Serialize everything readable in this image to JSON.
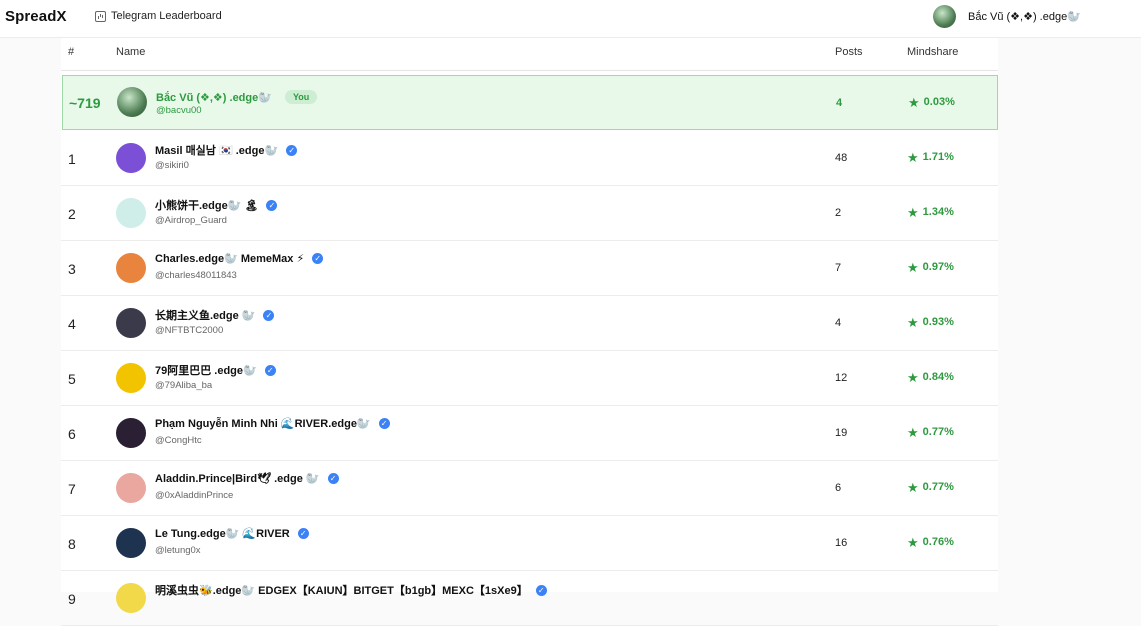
{
  "header": {
    "brand": "SpreadX",
    "nav_link": "Telegram Leaderboard",
    "user_name": "Bắc Vũ (❖,❖) .edge🦭"
  },
  "table": {
    "columns": {
      "rank": "#",
      "name": "Name",
      "posts": "Posts",
      "mindshare": "Mindshare"
    },
    "you_row": {
      "rank": "~719",
      "name": "Bắc Vũ (❖,❖) .edge🦭",
      "badge": "You",
      "handle": "@bacvu00",
      "posts": "4",
      "mindshare": "0.03%"
    },
    "rows": [
      {
        "rank": "1",
        "name": "Masil 매실남 🇰🇷 .edge🦭",
        "handle": "@sikiri0",
        "posts": "48",
        "mindshare": "1.71%",
        "color": "#7b4fd6"
      },
      {
        "rank": "2",
        "name": "小熊饼干.edge🦭 🏝",
        "handle": "@Airdrop_Guard",
        "posts": "2",
        "mindshare": "1.34%",
        "color": "#cfeee9"
      },
      {
        "rank": "3",
        "name": "Charles.edge🦭 MemeMax ⚡",
        "handle": "@charles48011843",
        "posts": "7",
        "mindshare": "0.97%",
        "color": "#e8843e"
      },
      {
        "rank": "4",
        "name": "长期主义鱼.edge 🦭",
        "handle": "@NFTBTC2000",
        "posts": "4",
        "mindshare": "0.93%",
        "color": "#3a3a4a"
      },
      {
        "rank": "5",
        "name": "79阿里巴巴 .edge🦭",
        "handle": "@79Aliba_ba",
        "posts": "12",
        "mindshare": "0.84%",
        "color": "#f2c400"
      },
      {
        "rank": "6",
        "name": "Phạm Nguyễn Minh Nhi 🌊RIVER.edge🦭",
        "handle": "@CongHtc",
        "posts": "19",
        "mindshare": "0.77%",
        "color": "#2a1f33"
      },
      {
        "rank": "7",
        "name": "Aladdin.Prince|Bird🕊 .edge 🦭",
        "handle": "@0xAladdinPrince",
        "posts": "6",
        "mindshare": "0.77%",
        "color": "#e9a7a0"
      },
      {
        "rank": "8",
        "name": "Le Tung.edge🦭 🌊RIVER",
        "handle": "@letung0x",
        "posts": "16",
        "mindshare": "0.76%",
        "color": "#1e3350"
      },
      {
        "rank": "9",
        "name": "明溪虫虫🐝.edge🦭 EDGEX【KAIUN】BITGET【b1gb】MEXC【1sXe9】",
        "handle": "",
        "posts": "",
        "mindshare": "",
        "color": "#f2d94a"
      }
    ]
  }
}
